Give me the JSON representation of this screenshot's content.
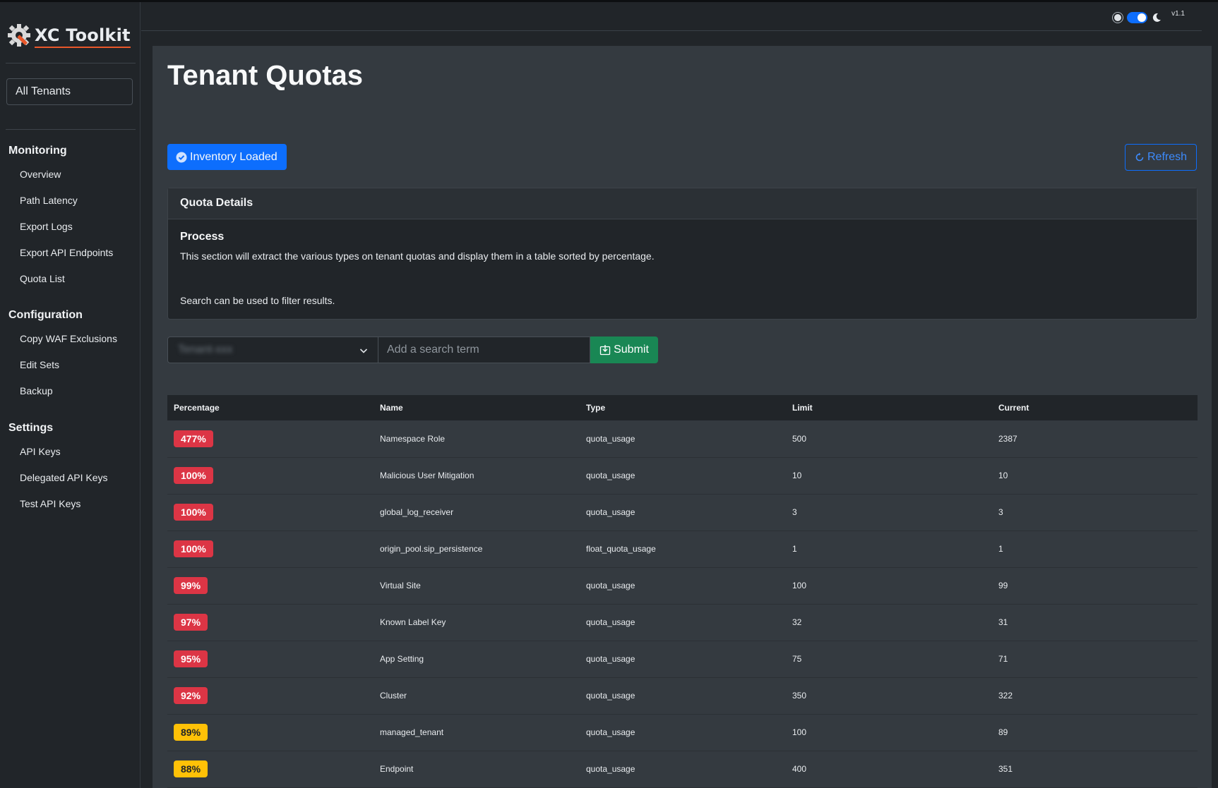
{
  "app": {
    "name": "XC Toolkit",
    "version": "v1.1"
  },
  "sidebar": {
    "tenant_button": "All Tenants",
    "sections": [
      {
        "title": "Monitoring",
        "items": [
          "Overview",
          "Path Latency",
          "Export Logs",
          "Export API Endpoints",
          "Quota List"
        ]
      },
      {
        "title": "Configuration",
        "items": [
          "Copy WAF Exclusions",
          "Edit Sets",
          "Backup"
        ]
      },
      {
        "title": "Settings",
        "items": [
          "API Keys",
          "Delegated API Keys",
          "Test API Keys"
        ]
      }
    ]
  },
  "page": {
    "title": "Tenant Quotas",
    "inventory_badge": "Inventory Loaded",
    "refresh_label": "Refresh"
  },
  "quota_card": {
    "header": "Quota Details",
    "title": "Process",
    "text1": "This section will extract the various types on tenant quotas and display them in a table sorted by percentage.",
    "text2": "Search can be used to filter results."
  },
  "search": {
    "select_value": "Tenant-xxx",
    "placeholder": "Add a search term",
    "submit_label": "Submit"
  },
  "table": {
    "headers": [
      "Percentage",
      "Name",
      "Type",
      "Limit",
      "Current"
    ],
    "rows": [
      {
        "pct": "477%",
        "level": "red",
        "name": "Namespace Role",
        "type": "quota_usage",
        "limit": "500",
        "current": "2387"
      },
      {
        "pct": "100%",
        "level": "red",
        "name": "Malicious User Mitigation",
        "type": "quota_usage",
        "limit": "10",
        "current": "10"
      },
      {
        "pct": "100%",
        "level": "red",
        "name": "global_log_receiver",
        "type": "quota_usage",
        "limit": "3",
        "current": "3"
      },
      {
        "pct": "100%",
        "level": "red",
        "name": "origin_pool.sip_persistence",
        "type": "float_quota_usage",
        "limit": "1",
        "current": "1"
      },
      {
        "pct": "99%",
        "level": "red",
        "name": "Virtual Site",
        "type": "quota_usage",
        "limit": "100",
        "current": "99"
      },
      {
        "pct": "97%",
        "level": "red",
        "name": "Known Label Key",
        "type": "quota_usage",
        "limit": "32",
        "current": "31"
      },
      {
        "pct": "95%",
        "level": "red",
        "name": "App Setting",
        "type": "quota_usage",
        "limit": "75",
        "current": "71"
      },
      {
        "pct": "92%",
        "level": "red",
        "name": "Cluster",
        "type": "quota_usage",
        "limit": "350",
        "current": "322"
      },
      {
        "pct": "89%",
        "level": "yellow",
        "name": "managed_tenant",
        "type": "quota_usage",
        "limit": "100",
        "current": "89"
      },
      {
        "pct": "88%",
        "level": "yellow",
        "name": "Endpoint",
        "type": "quota_usage",
        "limit": "400",
        "current": "351"
      }
    ]
  },
  "colors": {
    "background": "#212529",
    "card": "#343a40",
    "primary": "#0d6efd",
    "success": "#198754",
    "danger": "#dc3545",
    "warning": "#ffc107",
    "brand_accent": "#e8572a"
  },
  "icons": [
    "gear-wrench-icon",
    "sun-icon",
    "moon-icon",
    "check-circle-icon",
    "refresh-icon",
    "chevron-down-icon",
    "download-box-icon"
  ]
}
